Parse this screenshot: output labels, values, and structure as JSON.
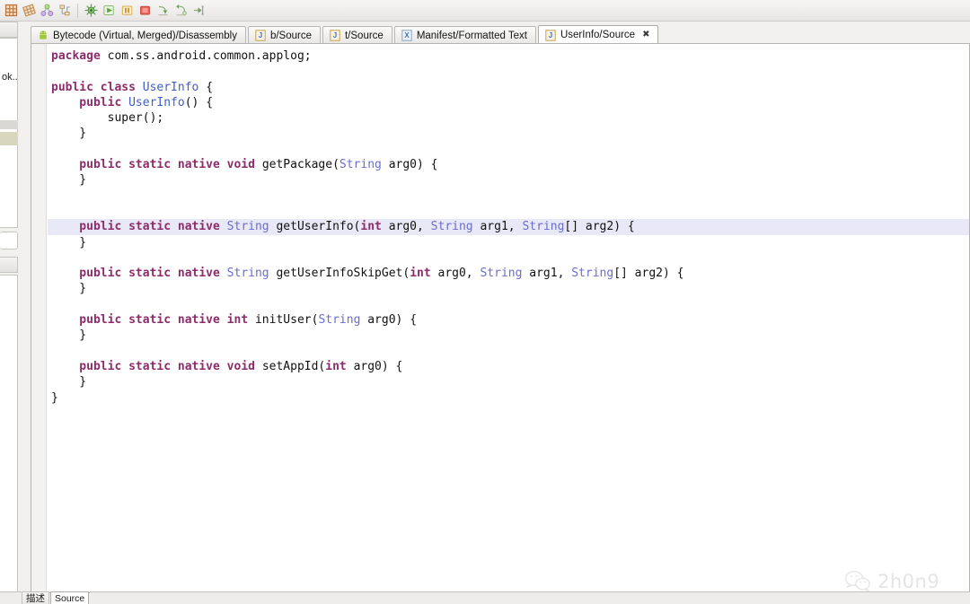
{
  "toolbar": {
    "buttons": [
      {
        "name": "open-type-icon",
        "label": "Open Type"
      },
      {
        "name": "cube-grid-icon",
        "label": "Open Package"
      },
      {
        "name": "cube-skew-icon",
        "label": "Open Resource"
      },
      {
        "name": "hierarchy-balls-icon",
        "label": "Open Task"
      },
      {
        "name": "hierarchy-tree-icon",
        "label": "Open Type Hierarchy"
      },
      {
        "name": "debug-icon",
        "label": "Debug"
      },
      {
        "name": "run-icon",
        "label": "Run"
      },
      {
        "name": "pause-icon",
        "label": "Suspend"
      },
      {
        "name": "stop-icon",
        "label": "Terminate"
      },
      {
        "name": "step-into-icon",
        "label": "Step Into"
      },
      {
        "name": "step-over-icon",
        "label": "Step Over"
      },
      {
        "name": "step-return-icon",
        "label": "Step Return"
      }
    ]
  },
  "leftdock": {
    "truncated_label": "ok.."
  },
  "tabs": [
    {
      "label": "Bytecode (Virtual, Merged)/Disassembly",
      "icon": "android-icon",
      "active": false,
      "closable": false
    },
    {
      "label": "b/Source",
      "icon": "java-icon",
      "active": false,
      "closable": false
    },
    {
      "label": "t/Source",
      "icon": "java-icon",
      "active": false,
      "closable": false
    },
    {
      "label": "Manifest/Formatted Text",
      "icon": "xml-icon",
      "active": false,
      "closable": false
    },
    {
      "label": "UserInfo/Source",
      "icon": "java-icon",
      "active": true,
      "closable": true,
      "close_glyph": "✖"
    }
  ],
  "editor": {
    "language": "java",
    "highlighted_line_index": 11,
    "lines": [
      [
        {
          "t": "package",
          "c": "kw"
        },
        {
          "t": " com.ss.android.common.applog;",
          "c": "pln"
        }
      ],
      [
        {
          "t": "",
          "c": "pln"
        }
      ],
      [
        {
          "t": "public class ",
          "c": "kw"
        },
        {
          "t": "UserInfo",
          "c": "blu"
        },
        {
          "t": " {",
          "c": "pln"
        }
      ],
      [
        {
          "t": "    public ",
          "c": "kw"
        },
        {
          "t": "UserInfo",
          "c": "blu"
        },
        {
          "t": "() {",
          "c": "pln"
        }
      ],
      [
        {
          "t": "        super();",
          "c": "pln"
        }
      ],
      [
        {
          "t": "    }",
          "c": "pln"
        }
      ],
      [
        {
          "t": "",
          "c": "pln"
        }
      ],
      [
        {
          "t": "    public static native void ",
          "c": "kw"
        },
        {
          "t": "getPackage(",
          "c": "pln"
        },
        {
          "t": "String",
          "c": "typ"
        },
        {
          "t": " arg0) {",
          "c": "pln"
        }
      ],
      [
        {
          "t": "    }",
          "c": "pln"
        }
      ],
      [
        {
          "t": "",
          "c": "pln"
        }
      ],
      [
        {
          "t": "",
          "c": "pln"
        }
      ],
      [
        {
          "t": "    public static native ",
          "c": "kw"
        },
        {
          "t": "String",
          "c": "typ"
        },
        {
          "t": " getUserInfo(",
          "c": "pln"
        },
        {
          "t": "int",
          "c": "kw"
        },
        {
          "t": " arg0, ",
          "c": "pln"
        },
        {
          "t": "String",
          "c": "typ"
        },
        {
          "t": " arg1, ",
          "c": "pln"
        },
        {
          "t": "String",
          "c": "typ"
        },
        {
          "t": "[] arg2) {",
          "c": "pln"
        }
      ],
      [
        {
          "t": "    }",
          "c": "pln"
        }
      ],
      [
        {
          "t": "",
          "c": "pln"
        }
      ],
      [
        {
          "t": "    public static native ",
          "c": "kw"
        },
        {
          "t": "String",
          "c": "typ"
        },
        {
          "t": " getUserInfoSkipGet(",
          "c": "pln"
        },
        {
          "t": "int",
          "c": "kw"
        },
        {
          "t": " arg0, ",
          "c": "pln"
        },
        {
          "t": "String",
          "c": "typ"
        },
        {
          "t": " arg1, ",
          "c": "pln"
        },
        {
          "t": "String",
          "c": "typ"
        },
        {
          "t": "[] arg2) {",
          "c": "pln"
        }
      ],
      [
        {
          "t": "    }",
          "c": "pln"
        }
      ],
      [
        {
          "t": "",
          "c": "pln"
        }
      ],
      [
        {
          "t": "    public static native int ",
          "c": "kw"
        },
        {
          "t": "initUser(",
          "c": "pln"
        },
        {
          "t": "String",
          "c": "typ"
        },
        {
          "t": " arg0) {",
          "c": "pln"
        }
      ],
      [
        {
          "t": "    }",
          "c": "pln"
        }
      ],
      [
        {
          "t": "",
          "c": "pln"
        }
      ],
      [
        {
          "t": "    public static native void ",
          "c": "kw"
        },
        {
          "t": "setAppId(",
          "c": "pln"
        },
        {
          "t": "int",
          "c": "kw"
        },
        {
          "t": " arg0) {",
          "c": "pln"
        }
      ],
      [
        {
          "t": "    }",
          "c": "pln"
        }
      ],
      [
        {
          "t": "}",
          "c": "pln"
        }
      ]
    ]
  },
  "watermark": {
    "icon": "wechat-icon",
    "text": "2h0n9"
  },
  "bottom_tabs": [
    {
      "label": "描述",
      "active": false
    },
    {
      "label": "Source",
      "active": true
    }
  ],
  "colors": {
    "keyword": "#8d2c6b",
    "type": "#6a6dcd",
    "class_name": "#3f5fc4",
    "plain": "#111111",
    "line_highlight": "#e9e8f6",
    "editor_bg": "#ffffff",
    "chrome_bg": "#f1f0ef"
  }
}
